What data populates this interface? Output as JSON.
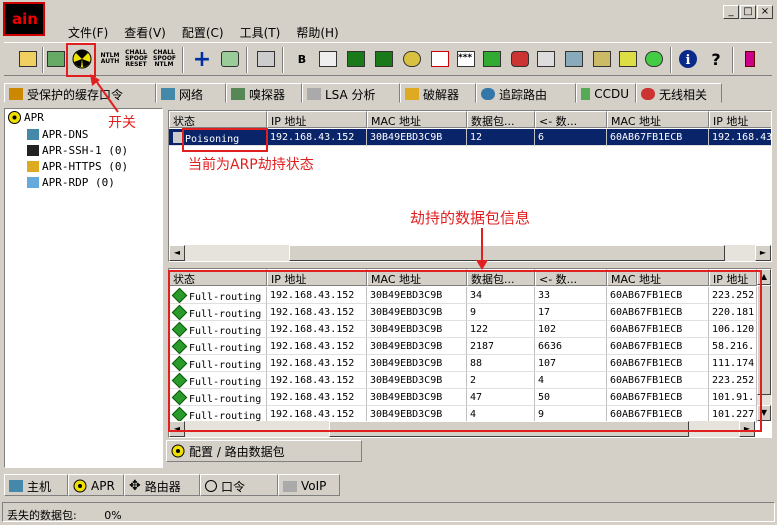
{
  "app": {
    "logo_text": "ain"
  },
  "menu": [
    "文件(F)",
    "查看(V)",
    "配置(C)",
    "工具(T)",
    "帮助(H)"
  ],
  "window_buttons": [
    "_",
    "□",
    "×"
  ],
  "toolbar": {
    "icons": [
      "open-folder-icon",
      "network-card-icon",
      "sniffer-toggle-icon",
      "ntlm-auth-icon",
      "chall-spoof-reset-icon",
      "chall-spoof-ntlm-icon",
      "add-icon",
      "recycle-icon",
      "calculator-icon",
      "base64-icon",
      "edit-icon",
      "certificate-icon",
      "vnc-icon",
      "key-icon",
      "rc-icon",
      "password-icon",
      "gauge-icon",
      "record-icon",
      "lock-icon",
      "network-icon",
      "pin-icon",
      "wireless-icon",
      "info-icon",
      "help-icon",
      "exit-icon"
    ],
    "ntlm_label": "NTLM AUTH",
    "chall_reset_label": "CHALL SPOOF RESET",
    "chall_ntlm_label": "CHALL SPOOF NTLM"
  },
  "tabs": [
    {
      "label": "受保护的缓存口令",
      "icon": "protected-cache-icon"
    },
    {
      "label": "网络",
      "icon": "network-icon"
    },
    {
      "label": "嗅探器",
      "icon": "sniffer-icon"
    },
    {
      "label": "LSA 分析",
      "icon": "lsa-icon"
    },
    {
      "label": "破解器",
      "icon": "cracker-icon"
    },
    {
      "label": "追踪路由",
      "icon": "traceroute-icon"
    },
    {
      "label": "CCDU",
      "icon": "ccdu-icon"
    },
    {
      "label": "无线相关",
      "icon": "wireless-icon"
    }
  ],
  "tree": {
    "root": "APR",
    "children": [
      "APR-DNS",
      "APR-SSH-1  (0)",
      "APR-HTTPS  (0)",
      "APR-RDP  (0)"
    ]
  },
  "top_table": {
    "headers": [
      "状态",
      "IP 地址",
      "MAC 地址",
      "数据包...",
      "<- 数...",
      "MAC 地址",
      "IP 地址"
    ],
    "rows": [
      [
        "Poisoning",
        "192.168.43.152",
        "30B49EBD3C9B",
        "12",
        "6",
        "60AB67FB1ECB",
        "192.168.43"
      ]
    ]
  },
  "bottom_table": {
    "headers": [
      "状态",
      "IP 地址",
      "MAC 地址",
      "数据包...",
      "<- 数...",
      "MAC 地址",
      "IP 地址"
    ],
    "rows": [
      [
        "Full-routing",
        "192.168.43.152",
        "30B49EBD3C9B",
        "34",
        "33",
        "60AB67FB1ECB",
        "223.252"
      ],
      [
        "Full-routing",
        "192.168.43.152",
        "30B49EBD3C9B",
        "9",
        "17",
        "60AB67FB1ECB",
        "220.181"
      ],
      [
        "Full-routing",
        "192.168.43.152",
        "30B49EBD3C9B",
        "122",
        "102",
        "60AB67FB1ECB",
        "106.120"
      ],
      [
        "Full-routing",
        "192.168.43.152",
        "30B49EBD3C9B",
        "2187",
        "6636",
        "60AB67FB1ECB",
        "58.216."
      ],
      [
        "Full-routing",
        "192.168.43.152",
        "30B49EBD3C9B",
        "88",
        "107",
        "60AB67FB1ECB",
        "111.174"
      ],
      [
        "Full-routing",
        "192.168.43.152",
        "30B49EBD3C9B",
        "2",
        "4",
        "60AB67FB1ECB",
        "223.252"
      ],
      [
        "Full-routing",
        "192.168.43.152",
        "30B49EBD3C9B",
        "47",
        "50",
        "60AB67FB1ECB",
        "101.91."
      ],
      [
        "Full-routing",
        "192.168.43.152",
        "30B49EBD3C9B",
        "4",
        "9",
        "60AB67FB1ECB",
        "101.227"
      ]
    ]
  },
  "subtab": "配置 / 路由数据包",
  "annotations": {
    "switch": "开关",
    "arp_state": "当前为ARP劫持状态",
    "packets": "劫持的数据包信息"
  },
  "bottom_tabs": [
    {
      "label": "主机",
      "icon": "host-icon"
    },
    {
      "label": "APR",
      "icon": "apr-icon"
    },
    {
      "label": "路由器",
      "icon": "router-icon"
    },
    {
      "label": "口令",
      "icon": "password-icon"
    },
    {
      "label": "VoIP",
      "icon": "voip-icon"
    }
  ],
  "status": {
    "label": "丢失的数据包:",
    "value": "0%"
  },
  "colors": {
    "annotation": "#e02020",
    "selection": "#0a246a",
    "routing_green": "#2a9a2a"
  }
}
